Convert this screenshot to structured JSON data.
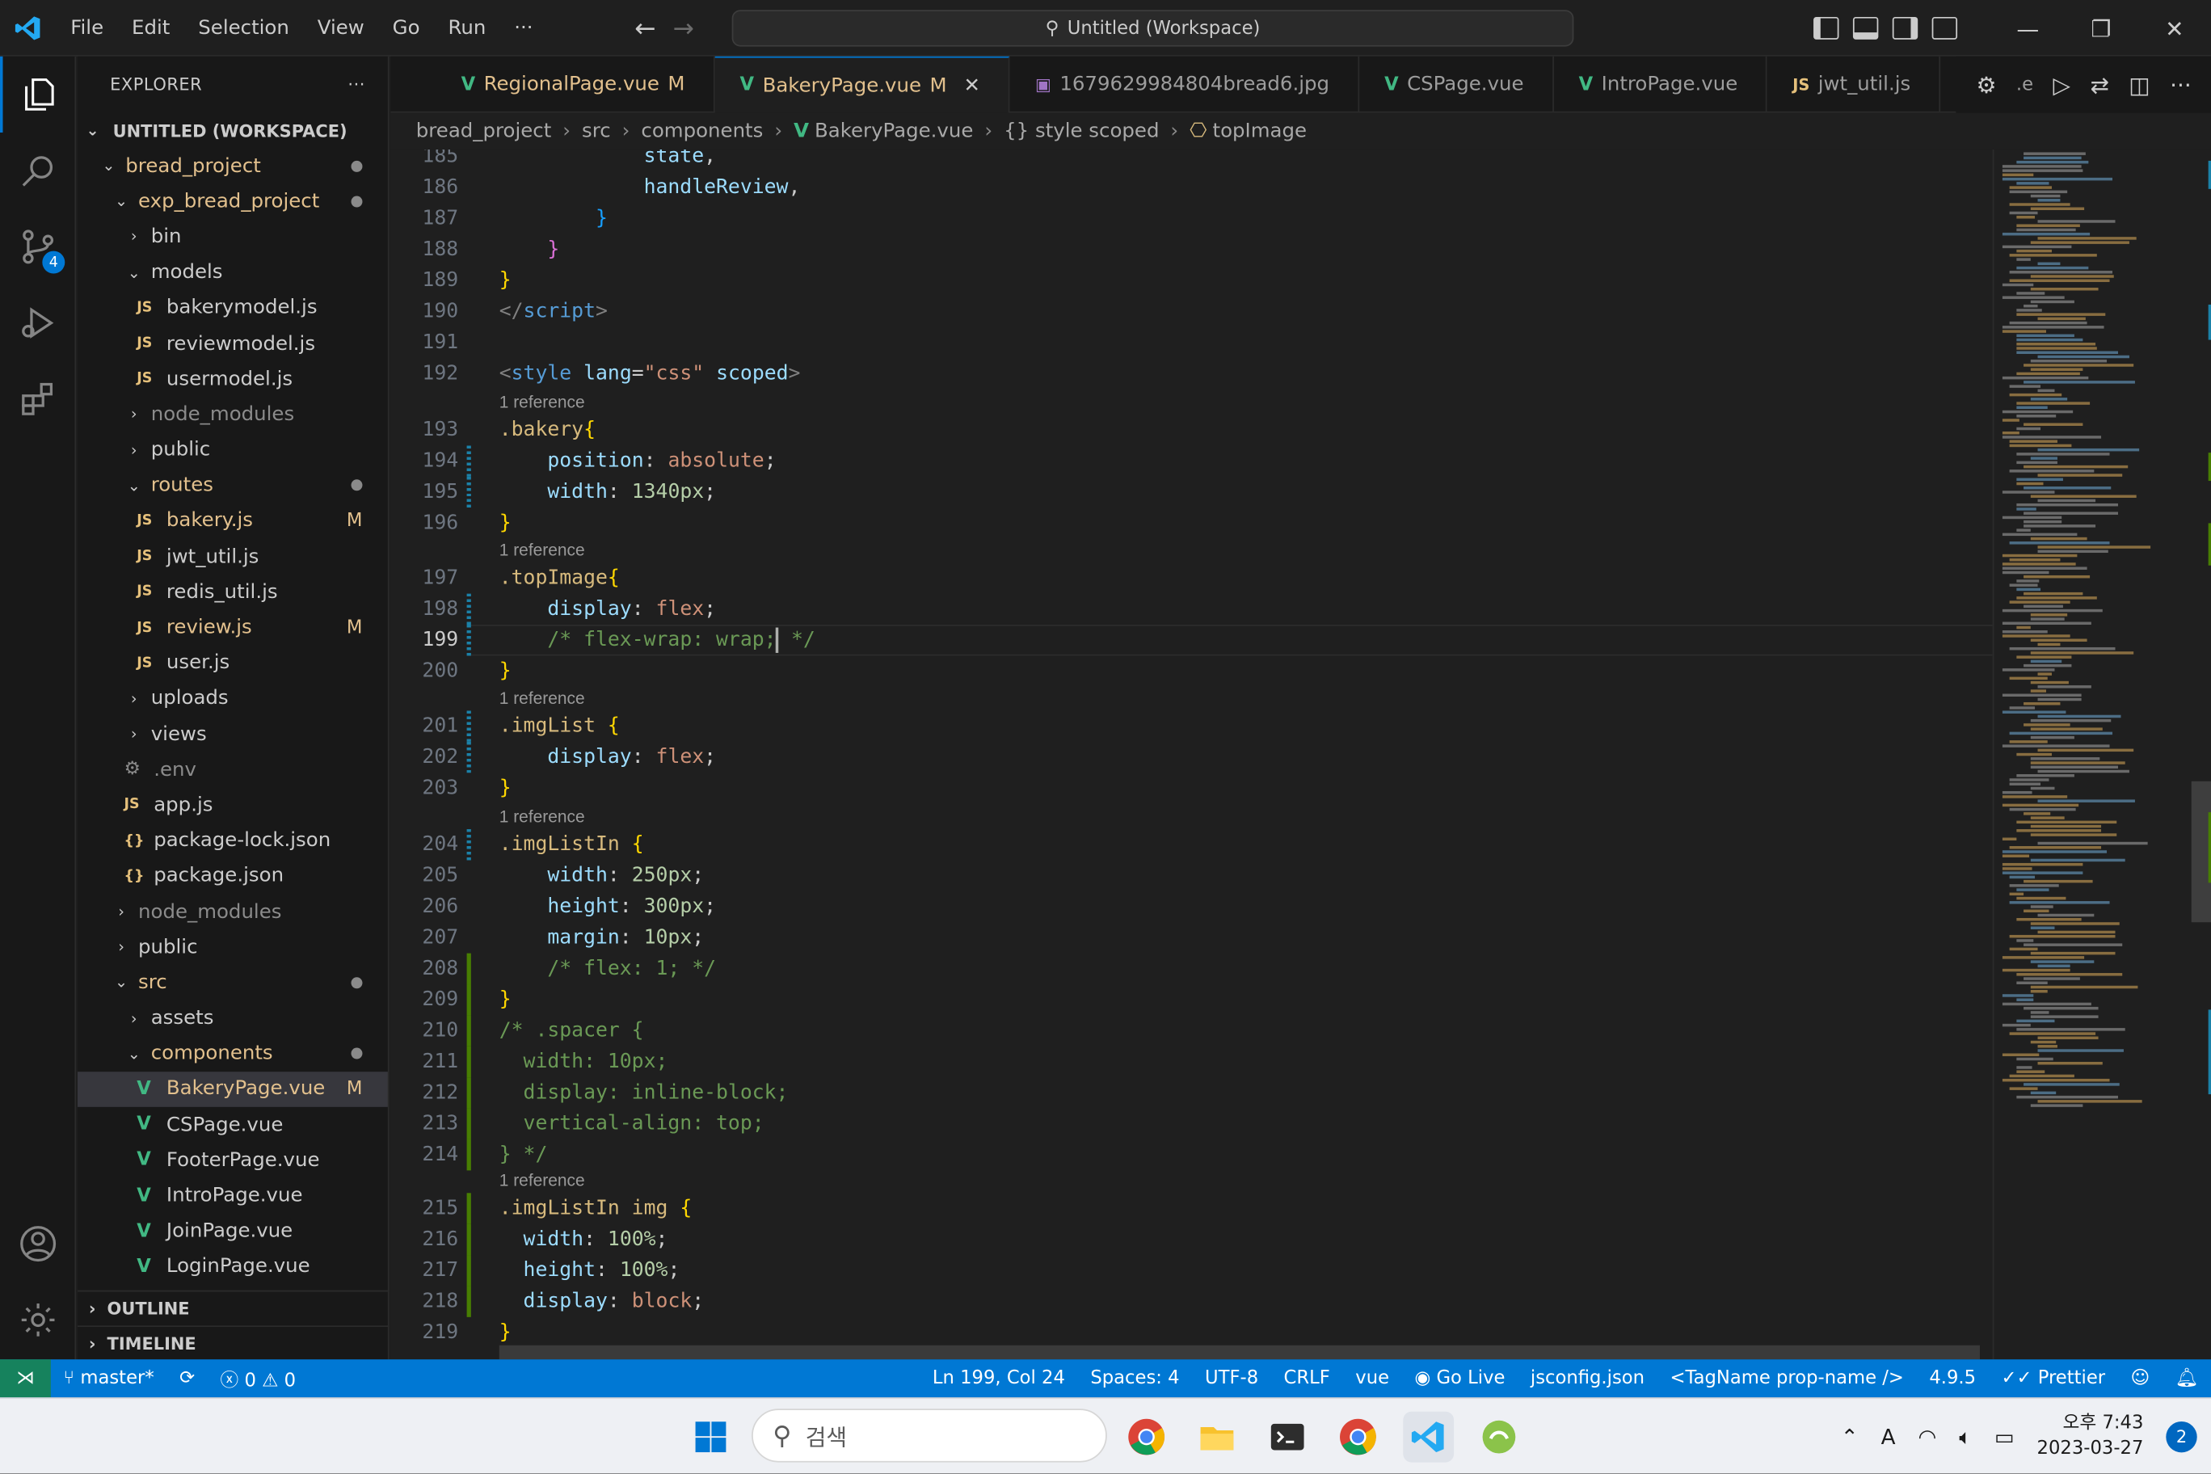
{
  "titlebar": {
    "menu": [
      "File",
      "Edit",
      "Selection",
      "View",
      "Go",
      "Run",
      "···"
    ],
    "search_text": "Untitled (Workspace)"
  },
  "explorer": {
    "header": "EXPLORER",
    "more": "···",
    "workspace": "UNTITLED (WORKSPACE)",
    "outline": "OUTLINE",
    "timeline": "TIMELINE"
  },
  "tree": [
    {
      "label": "bread_project",
      "indent": 1,
      "type": "folder-open",
      "color": "mod",
      "dot": true
    },
    {
      "label": "exp_bread_project",
      "indent": 2,
      "type": "folder-open",
      "color": "mod",
      "dot": true
    },
    {
      "label": "bin",
      "indent": 3,
      "type": "folder-closed"
    },
    {
      "label": "models",
      "indent": 3,
      "type": "folder-open"
    },
    {
      "label": "bakerymodel.js",
      "indent": 4,
      "type": "js"
    },
    {
      "label": "reviewmodel.js",
      "indent": 4,
      "type": "js"
    },
    {
      "label": "usermodel.js",
      "indent": 4,
      "type": "js"
    },
    {
      "label": "node_modules",
      "indent": 3,
      "type": "folder-closed",
      "color": "dim"
    },
    {
      "label": "public",
      "indent": 3,
      "type": "folder-closed"
    },
    {
      "label": "routes",
      "indent": 3,
      "type": "folder-open",
      "color": "mod",
      "dot": true
    },
    {
      "label": "bakery.js",
      "indent": 4,
      "type": "js",
      "color": "mod",
      "badge": "M"
    },
    {
      "label": "jwt_util.js",
      "indent": 4,
      "type": "js"
    },
    {
      "label": "redis_util.js",
      "indent": 4,
      "type": "js"
    },
    {
      "label": "review.js",
      "indent": 4,
      "type": "js",
      "color": "mod",
      "badge": "M"
    },
    {
      "label": "user.js",
      "indent": 4,
      "type": "js"
    },
    {
      "label": "uploads",
      "indent": 3,
      "type": "folder-closed"
    },
    {
      "label": "views",
      "indent": 3,
      "type": "folder-closed"
    },
    {
      "label": ".env",
      "indent": 3,
      "type": "env",
      "color": "dim"
    },
    {
      "label": "app.js",
      "indent": 3,
      "type": "js"
    },
    {
      "label": "package-lock.json",
      "indent": 3,
      "type": "json"
    },
    {
      "label": "package.json",
      "indent": 3,
      "type": "json"
    },
    {
      "label": "node_modules",
      "indent": 2,
      "type": "folder-closed",
      "color": "dim"
    },
    {
      "label": "public",
      "indent": 2,
      "type": "folder-closed"
    },
    {
      "label": "src",
      "indent": 2,
      "type": "folder-open",
      "color": "mod",
      "dot": true
    },
    {
      "label": "assets",
      "indent": 3,
      "type": "folder-closed"
    },
    {
      "label": "components",
      "indent": 3,
      "type": "folder-open",
      "color": "mod",
      "dot": true
    },
    {
      "label": "BakeryPage.vue",
      "indent": 4,
      "type": "vue",
      "color": "mod",
      "badge": "M",
      "selected": true
    },
    {
      "label": "CSPage.vue",
      "indent": 4,
      "type": "vue"
    },
    {
      "label": "FooterPage.vue",
      "indent": 4,
      "type": "vue"
    },
    {
      "label": "IntroPage.vue",
      "indent": 4,
      "type": "vue"
    },
    {
      "label": "JoinPage.vue",
      "indent": 4,
      "type": "vue"
    },
    {
      "label": "LoginPage.vue",
      "indent": 4,
      "type": "vue"
    }
  ],
  "tabs": [
    {
      "label": "RegionalPage.vue",
      "kind": "vue",
      "mod": "M"
    },
    {
      "label": "BakeryPage.vue",
      "kind": "vue",
      "mod": "M",
      "active": true
    },
    {
      "label": "1679629984804bread6.jpg",
      "kind": "img"
    },
    {
      "label": "CSPage.vue",
      "kind": "vue"
    },
    {
      "label": "IntroPage.vue",
      "kind": "vue"
    },
    {
      "label": "jwt_util.js",
      "kind": "js"
    }
  ],
  "tab_overflow": ".e",
  "breadcrumb": [
    "bread_project",
    "src",
    "components",
    "BakeryPage.vue",
    "{} style scoped",
    "topImage"
  ],
  "reference_label": "1 reference",
  "cursor_line": 199,
  "statusbar": {
    "branch": "master*",
    "errors": "0",
    "warnings": "0",
    "position": "Ln 199, Col 24",
    "spaces": "Spaces: 4",
    "encoding": "UTF-8",
    "eol": "CRLF",
    "language": "vue",
    "golive": "Go Live",
    "config": "jsconfig.json",
    "tagname": "<TagName prop-name />",
    "version": "4.9.5",
    "prettier": "Prettier"
  },
  "taskbar": {
    "search": "검색",
    "time": "오후 7:43",
    "date": "2023-03-27",
    "notifications": "2",
    "ime": "A"
  },
  "colors": {
    "accent": "#0078d4",
    "statusbar": "#0078d4",
    "remote": "#16825d",
    "modified": "#e2c08d",
    "vue": "#41b883"
  }
}
